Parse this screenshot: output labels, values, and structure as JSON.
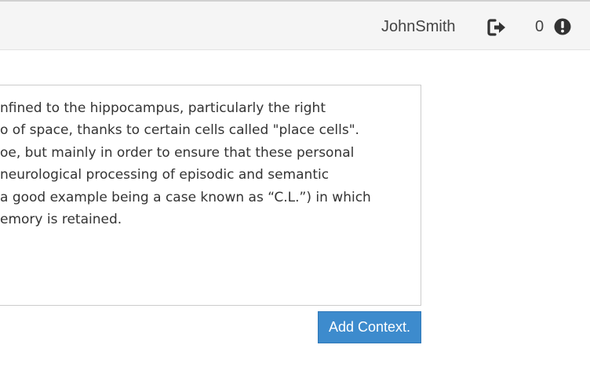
{
  "header": {
    "username": "JohnSmith",
    "logout_icon": "logout-icon",
    "notification_count": "0",
    "alert_icon": "exclamation-circle-icon"
  },
  "editor": {
    "lines": [
      "nfined to the  hippocampus, particularly the right",
      "o of space, thanks to certain cells called \"place cells\".",
      "oe,  but mainly in order to ensure that these personal",
      " neurological processing  of episodic and semantic",
      "a good example being a case known as “C.L.”) in which",
      "emory is retained."
    ]
  },
  "actions": {
    "add_context_label": "Add Context."
  },
  "colors": {
    "topbar_bg": "#f5f5f5",
    "button_bg": "#3d8bcd",
    "text": "#333333"
  }
}
